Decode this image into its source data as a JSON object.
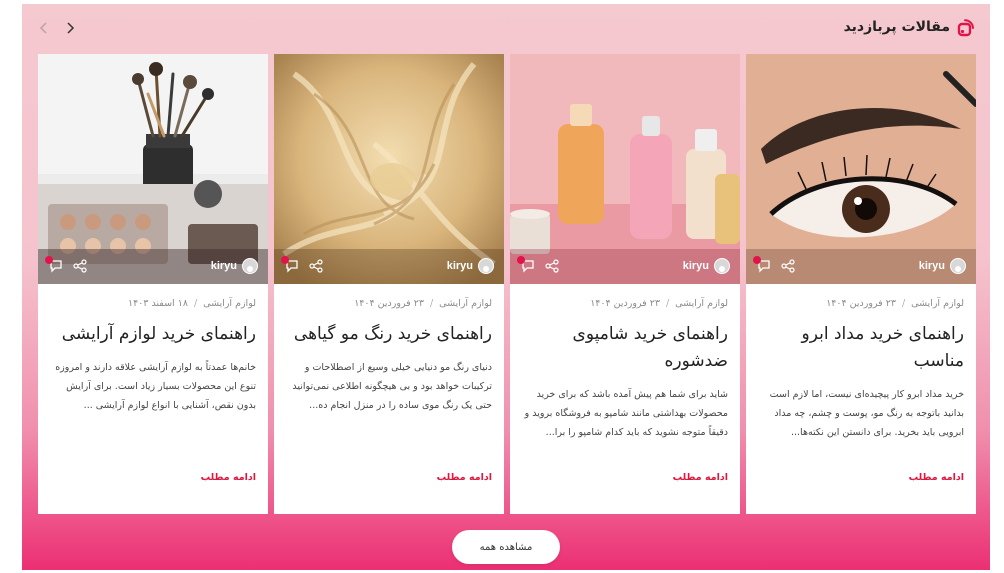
{
  "section": {
    "title": "مقالات پربازدید",
    "icon": "signal-icon",
    "brand_color": "#e1134a",
    "view_all_label": "مشاهده همه"
  },
  "nav": {
    "prev_icon": "chevron-left-icon",
    "next_icon": "chevron-right-icon"
  },
  "cards": [
    {
      "image": "eyebrow-makeup-photo",
      "author": "kiryu",
      "category": "لوازم آرایشی",
      "date": "۲۳ فروردین ۱۴۰۴",
      "title": "راهنمای خرید مداد ابرو مناسب",
      "excerpt": "خرید مداد ابرو کار پیچیده‌ای نیست، اما لازم است بدانید باتوجه به رنگ مو، پوست و چشم، چه مداد ابرویی باید بخرید. برای دانستن این نکته‌ها...",
      "read_more": "ادامه مطلب"
    },
    {
      "image": "shampoo-bottles-photo",
      "author": "kiryu",
      "category": "لوازم آرایشی",
      "date": "۲۳ فروردین ۱۴۰۴",
      "title": "راهنمای خرید شامپوی ضدشوره",
      "excerpt": "شاید برای شما هم پیش آمده باشد که برای خرید محصولات بهداشتی مانند شامپو به فروشگاه بروید و دقیقاً متوجه نشوید که باید کدام شامپو را برا...",
      "read_more": "ادامه مطلب"
    },
    {
      "image": "blonde-hair-photo",
      "author": "kiryu",
      "category": "لوازم آرایشی",
      "date": "۲۳ فروردین ۱۴۰۴",
      "title": "راهنمای خرید رنگ مو گیاهی",
      "excerpt": "دنیای رنگ مو دنیایی خیلی وسیع از اصطلاحات و ترکیبات خواهد بود و بی هیچگونه اطلاعی نمی‌توانید حتی یک رنگ موی ساده را در منزل انجام ده...",
      "read_more": "ادامه مطلب"
    },
    {
      "image": "makeup-tools-photo",
      "author": "kiryu",
      "category": "لوازم آرایشی",
      "date": "۱۸ اسفند ۱۴۰۳",
      "title": "راهنمای خرید لوازم آرایشی",
      "excerpt": "خانم‌ها عمدتاً به لوازم آرایشی علاقه دارند و امروزه تنوع این محصولات بسیار زیاد است. برای آرایش بدون نقص، آشنایی با انواع لوازم آرایشی ...",
      "read_more": "ادامه مطلب"
    }
  ]
}
